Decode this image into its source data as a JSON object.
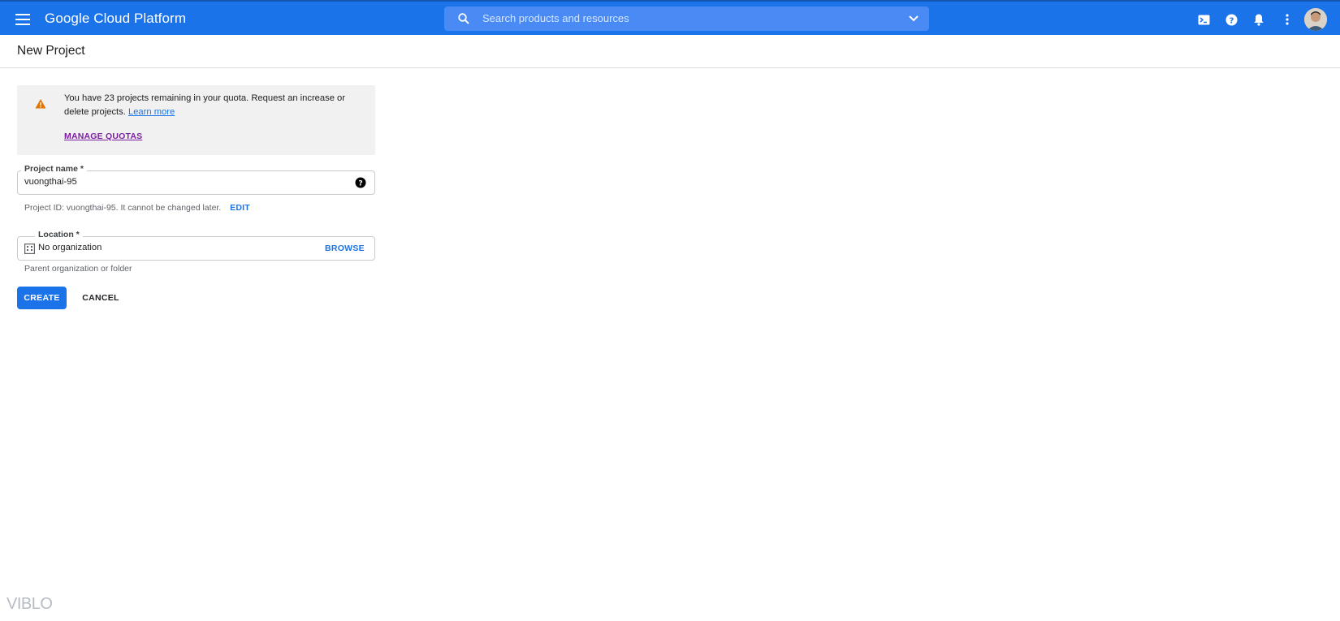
{
  "header": {
    "brand": "Google Cloud Platform",
    "search_placeholder": "Search products and resources",
    "icons": [
      "menu-icon",
      "search-icon",
      "chevron-down-icon",
      "cloud-shell-icon",
      "help-icon",
      "notifications-icon",
      "more-vert-icon"
    ],
    "accent_color": "#1a73e8"
  },
  "page": {
    "title": "New Project"
  },
  "quota_notice": {
    "message": "You have 23 projects remaining in your quota. Request an increase or delete projects.",
    "learn_more": "Learn more",
    "manage_quotas": "MANAGE QUOTAS"
  },
  "project_name": {
    "label": "Project name *",
    "value": "vuongthai-95",
    "hint": "Project ID: vuongthai-95. It cannot be changed later.",
    "edit": "EDIT"
  },
  "location": {
    "label": "Location *",
    "value": "No organization",
    "browse": "BROWSE",
    "hint": "Parent organization or folder"
  },
  "actions": {
    "create": "CREATE",
    "cancel": "CANCEL"
  },
  "watermark": "VIBLO"
}
